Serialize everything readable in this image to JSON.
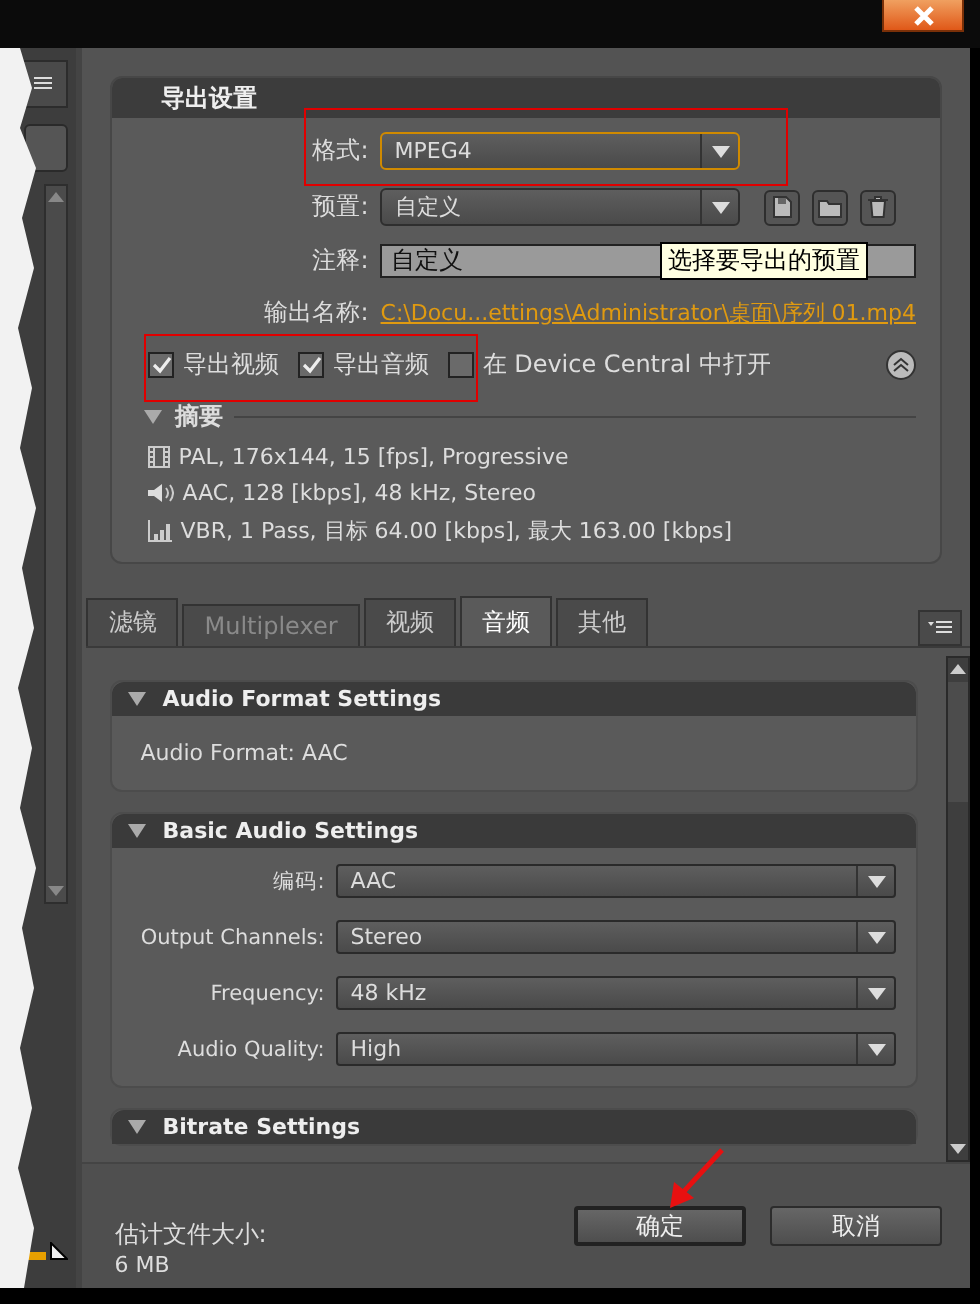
{
  "export_settings": {
    "title": "导出设置",
    "format": {
      "label": "格式:",
      "value": "MPEG4"
    },
    "preset": {
      "label": "预置:",
      "value": "自定义"
    },
    "comment": {
      "label": "注释:",
      "value": "自定义"
    },
    "tooltip": "选择要导出的预置",
    "output": {
      "label": "输出名称:",
      "value": "C:\\Docu...ettings\\Administrator\\桌面\\序列 01.mp4"
    },
    "checkboxes": [
      {
        "label": "导出视频",
        "checked": true
      },
      {
        "label": "导出音频",
        "checked": true
      },
      {
        "label": "在 Device Central 中打开",
        "checked": false
      }
    ],
    "summary": {
      "title": "摘要",
      "expanded": true,
      "lines": [
        {
          "kind": "video",
          "text": "PAL, 176x144, 15 [fps], Progressive"
        },
        {
          "kind": "audio",
          "text": "AAC, 128 [kbps], 48 kHz, Stereo"
        },
        {
          "kind": "bitrate",
          "text": "VBR, 1 Pass, 目标 64.00 [kbps], 最大 163.00 [kbps]"
        }
      ]
    }
  },
  "tabs": [
    {
      "label": "滤镜",
      "selected": false,
      "disabled": false
    },
    {
      "label": "Multiplexer",
      "selected": false,
      "disabled": true
    },
    {
      "label": "视频",
      "selected": false,
      "disabled": false
    },
    {
      "label": "音频",
      "selected": true,
      "disabled": false
    },
    {
      "label": "其他",
      "selected": false,
      "disabled": false
    }
  ],
  "sections": [
    {
      "title": "Audio Format Settings",
      "expanded": true,
      "fields": [
        {
          "kind": "text",
          "label": "Audio Format:",
          "value": "AAC"
        }
      ]
    },
    {
      "title": "Basic Audio Settings",
      "expanded": true,
      "fields": [
        {
          "kind": "select",
          "label": "编码:",
          "value": "AAC"
        },
        {
          "kind": "select",
          "label": "Output Channels:",
          "value": "Stereo"
        },
        {
          "kind": "select",
          "label": "Frequency:",
          "value": "48 kHz"
        },
        {
          "kind": "select",
          "label": "Audio Quality:",
          "value": "High"
        }
      ]
    },
    {
      "title": "Bitrate Settings",
      "expanded": true
    }
  ],
  "footer": {
    "estimate_label": "估计文件大小:",
    "estimate_value": "6 MB",
    "buttons": [
      {
        "label": "确定",
        "default": true
      },
      {
        "label": "取消",
        "default": false
      }
    ]
  }
}
